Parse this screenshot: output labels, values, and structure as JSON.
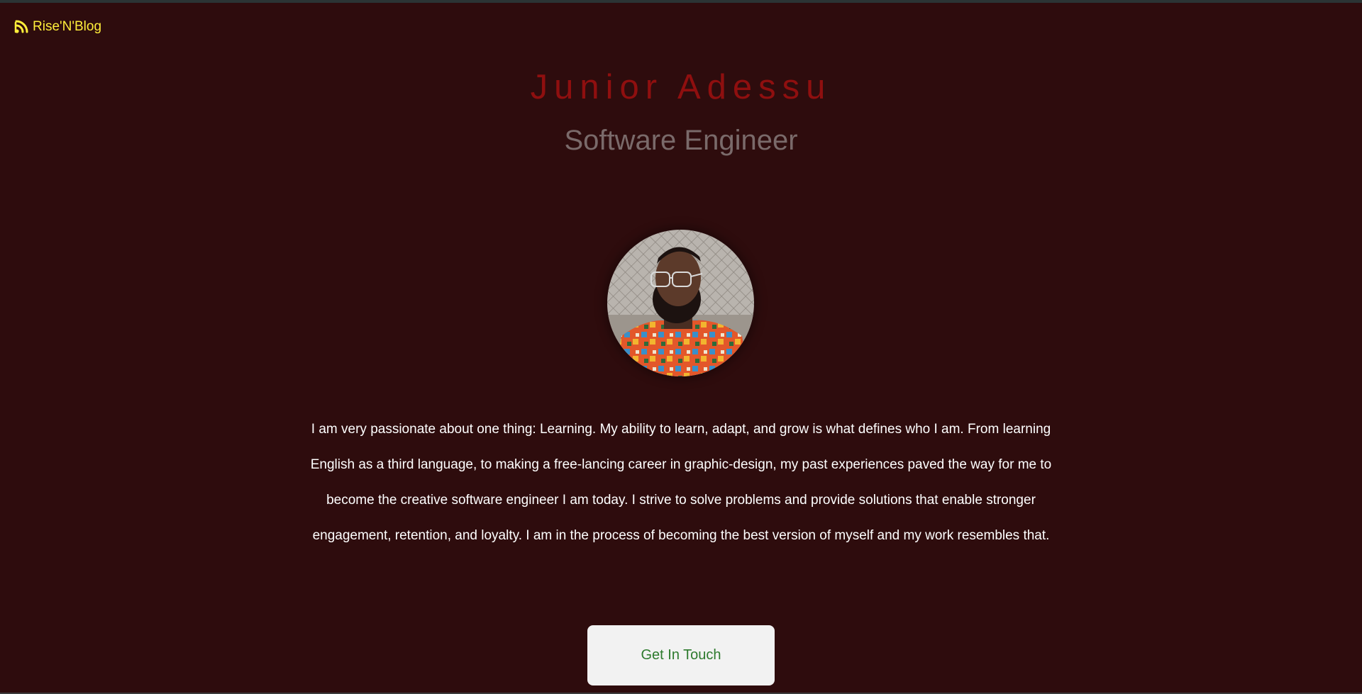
{
  "brand": {
    "icon": "rss-feed-icon",
    "label": "Rise'N'Blog",
    "color": "#ffee3a"
  },
  "hero": {
    "name": "Junior Adessu",
    "title": "Software Engineer"
  },
  "avatar": {
    "alt": "Portrait of Junior Adessu"
  },
  "bio": "I am very passionate about one thing: Learning. My ability to learn, adapt, and grow is what defines who I am. From learning English as a third language, to making a free-lancing career in graphic-design, my past experiences paved the way for me to become the creative software engineer I am today. I strive to solve problems and provide solutions that enable stronger engagement, retention, and loyalty. I am in the process of becoming the best version of myself and my work resembles that.",
  "cta": {
    "label": "Get In Touch"
  },
  "colors": {
    "background": "#2e0c0d",
    "name": "#8f0f0f",
    "title": "#7a6a6a",
    "cta_text": "#2d7a2d",
    "cta_bg": "#f2f2f2"
  }
}
